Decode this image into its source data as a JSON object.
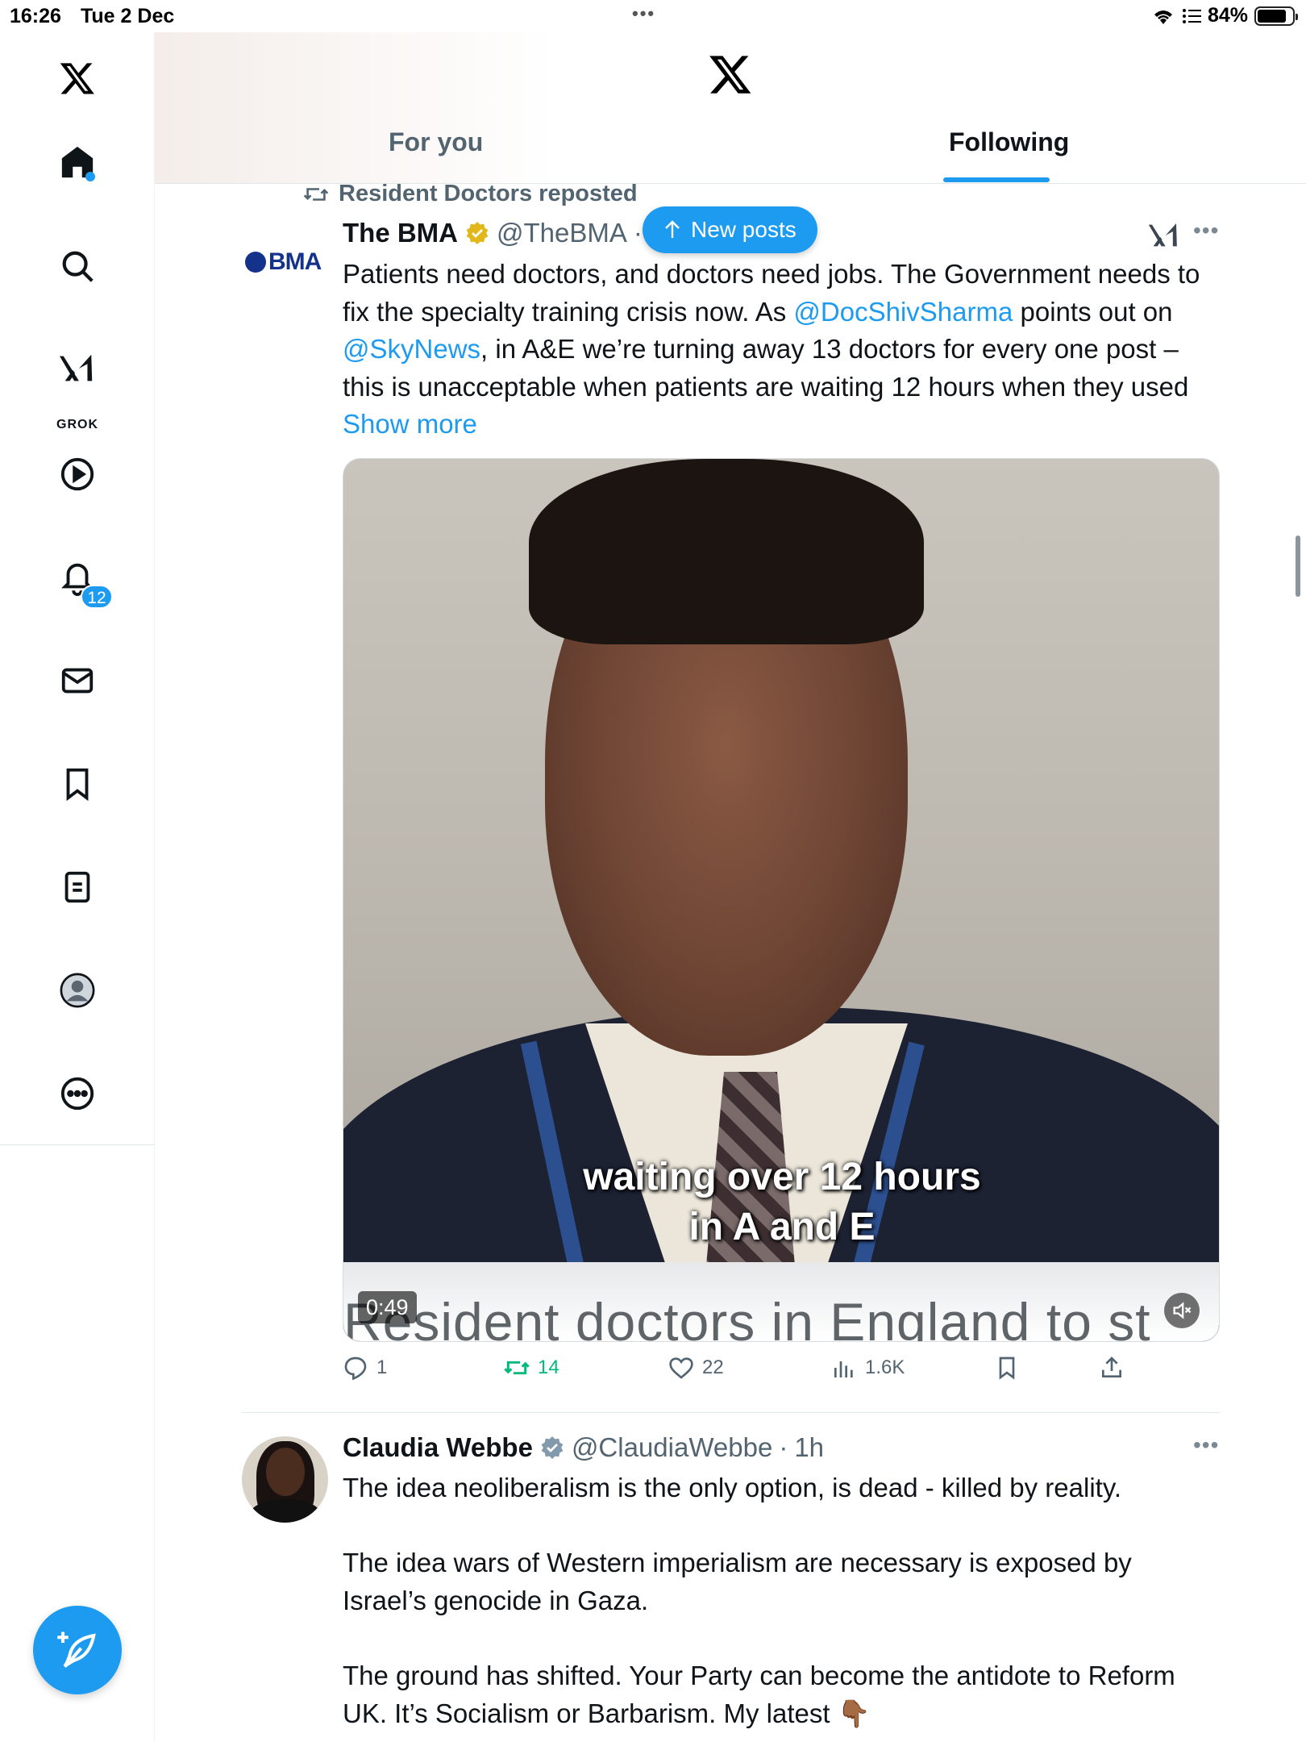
{
  "status_bar": {
    "time": "16:26",
    "date": "Tue 2 Dec",
    "battery": "84%",
    "battery_level": 0.84
  },
  "sidebar": {
    "items": [
      {
        "name": "home",
        "icon": "home-icon",
        "badge": "dot"
      },
      {
        "name": "search",
        "icon": "search-icon"
      },
      {
        "name": "grok",
        "icon": "grok-icon",
        "label": "GROK"
      },
      {
        "name": "video",
        "icon": "play-icon"
      },
      {
        "name": "notifications",
        "icon": "bell-icon",
        "badge": "12"
      },
      {
        "name": "messages",
        "icon": "mail-icon"
      },
      {
        "name": "bookmarks",
        "icon": "bookmark-icon"
      },
      {
        "name": "lists",
        "icon": "list-icon"
      },
      {
        "name": "profile",
        "icon": "profile-icon"
      },
      {
        "name": "more",
        "icon": "more-circle-icon"
      }
    ],
    "compose_icon": "compose-icon"
  },
  "header": {
    "tabs": [
      {
        "label": "For you",
        "active": false
      },
      {
        "label": "Following",
        "active": true
      }
    ]
  },
  "new_posts": {
    "label": "New posts"
  },
  "posts": [
    {
      "repost_label": "Resident Doctors reposted",
      "avatar_text": "BMA",
      "name": "The BMA",
      "handle": "@TheBMA",
      "separator": "·",
      "verified": "gold",
      "text_parts": [
        {
          "t": "Patients need doctors, and doctors need jobs. The Government needs to fix the specialty training crisis now. As "
        },
        {
          "t": "@DocShivSharma",
          "link": true
        },
        {
          "t": " points out on "
        },
        {
          "t": "@SkyNews",
          "link": true
        },
        {
          "t": ", in A&E we’re turning away 13 doctors for every one post – this is unacceptable when patients are waiting 12 hours when they used "
        },
        {
          "t": "Show more",
          "link": true
        }
      ],
      "media": {
        "caption_line1": "waiting over 12 hours",
        "caption_line2": "in A and E",
        "ticker": "Resident doctors in England to st",
        "duration": "0:49"
      },
      "stats": {
        "replies": "1",
        "reposts": "14",
        "likes": "22",
        "views": "1.6K"
      }
    },
    {
      "name": "Claudia Webbe",
      "handle": "@ClaudiaWebbe",
      "separator": "·",
      "time": "1h",
      "verified": "grey",
      "paragraphs": [
        "The idea neoliberalism is the only option, is dead - killed by reality.",
        "The idea wars of Western imperialism are necessary is exposed by Israel’s genocide in Gaza.",
        "The ground has shifted. Your Party can become the antidote to Reform UK. It’s Socialism or Barbarism. My latest 👇🏾"
      ]
    }
  ],
  "colors": {
    "accent": "#1d9bf0",
    "repost_green": "#00ba7c",
    "secondary_text": "#536471",
    "gold_check": "#e2b719",
    "grey_check": "#829aab"
  }
}
